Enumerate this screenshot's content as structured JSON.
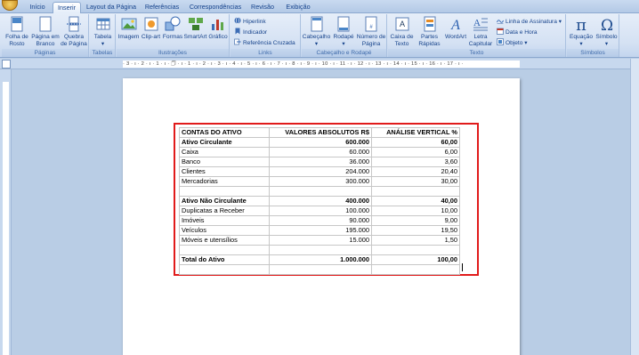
{
  "tabs": [
    "Início",
    "Inserir",
    "Layout da Página",
    "Referências",
    "Correspondências",
    "Revisão",
    "Exibição"
  ],
  "active_tab": "Inserir",
  "ribbon": {
    "groups": {
      "paginas": "Páginas",
      "tabelas": "Tabelas",
      "ilustracoes": "Ilustrações",
      "links": "Links",
      "cabecalho": "Cabeçalho e Rodapé",
      "texto": "Texto",
      "simbolos": "Símbolos"
    },
    "buttons": {
      "folha_rosto": "Folha de",
      "folha_rosto_2": "Rosto",
      "pagina_branco": "Página em",
      "pagina_branco_2": "Branco",
      "quebra_pagina": "Quebra",
      "quebra_pagina_2": "de Página",
      "tabela": "Tabela",
      "imagem": "Imagem",
      "clipart": "Clip-art",
      "formas": "Formas",
      "smartart": "SmartArt",
      "grafico": "Gráfico",
      "hiperlink": "Hiperlink",
      "indicador": "Indicador",
      "ref_cruzada": "Referência Cruzada",
      "cabecalho": "Cabeçalho",
      "rodape": "Rodapé",
      "num_pagina": "Número de",
      "num_pagina_2": "Página",
      "caixa_texto": "Caixa de",
      "caixa_texto_2": "Texto",
      "partes_rapidas": "Partes",
      "partes_rapidas_2": "Rápidas",
      "wordart": "WordArt",
      "letra_capitular": "Letra",
      "letra_capitular_2": "Capitular",
      "linha_assinatura": "Linha de Assinatura",
      "data_hora": "Data e Hora",
      "objeto": "Objeto",
      "equacao": "Equação",
      "simbolo": "Símbolo"
    }
  },
  "ruler_numbers": "· 3 · ı · 2 · ı · 1 · ı · 🗇 · ı · 1 · ı · 2 · ı · 3 · ı · 4 · ı · 5 · ı · 6 · ı · 7 · ı · 8 · ı · 9 · ı · 10 · ı · 11 · ı · 12 · ı · 13 · ı · 14 · ı · 15 · ı · 16 · ı · 17 · ı ·",
  "table": {
    "rows": [
      {
        "label": "CONTAS DO ATIVO",
        "absolute": "VALORES ABSOLUTOS R$",
        "vertical": "ANÁLISE VERTICAL %",
        "bold": true
      },
      {
        "label": "Ativo Circulante",
        "absolute": "600.000",
        "vertical": "60,00",
        "bold": true
      },
      {
        "label": "Caixa",
        "absolute": "60.000",
        "vertical": "6,00",
        "bold": false
      },
      {
        "label": "Banco",
        "absolute": "36.000",
        "vertical": "3,60",
        "bold": false
      },
      {
        "label": "Clientes",
        "absolute": "204.000",
        "vertical": "20,40",
        "bold": false
      },
      {
        "label": "Mercadorias",
        "absolute": "300.000",
        "vertical": "30,00",
        "bold": false
      },
      {
        "label": "",
        "absolute": "",
        "vertical": "",
        "bold": false
      },
      {
        "label": "Ativo Não Circulante",
        "absolute": "400.000",
        "vertical": "40,00",
        "bold": true
      },
      {
        "label": "Duplicatas a Receber",
        "absolute": "100.000",
        "vertical": "10,00",
        "bold": false
      },
      {
        "label": "Imóveis",
        "absolute": "90.000",
        "vertical": "9,00",
        "bold": false
      },
      {
        "label": "Veículos",
        "absolute": "195.000",
        "vertical": "19,50",
        "bold": false
      },
      {
        "label": "Móveis e utensílios",
        "absolute": "15.000",
        "vertical": "1,50",
        "bold": false
      },
      {
        "label": "",
        "absolute": "",
        "vertical": "",
        "bold": false
      },
      {
        "label": "Total do Ativo",
        "absolute": "1.000.000",
        "vertical": "100,00",
        "bold": true
      },
      {
        "label": "",
        "absolute": "",
        "vertical": "",
        "bold": false
      }
    ]
  },
  "colors": {
    "highlight_frame": "#e11b1b",
    "ribbon_text": "#15428b",
    "workspace": "#b9cde5"
  }
}
